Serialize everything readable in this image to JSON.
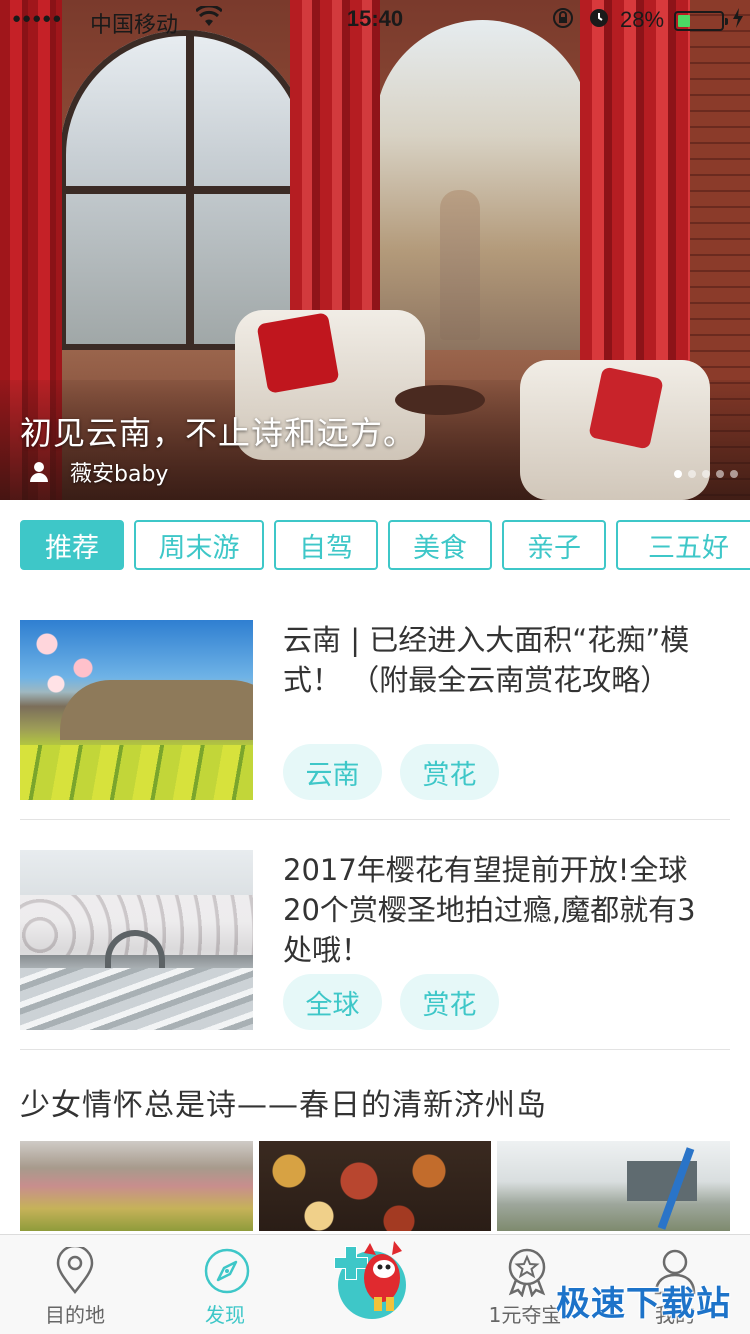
{
  "status_bar": {
    "signal": "●●●●●",
    "carrier": "中国移动",
    "time": "15:40",
    "battery_percent": "28%",
    "battery_level": 0.28,
    "icons": [
      "signal-icon",
      "wifi-icon",
      "orientation-lock-icon",
      "alarm-icon",
      "battery-icon",
      "charging-icon"
    ]
  },
  "hero": {
    "title": "初见云南，不止诗和远方。",
    "author": "薇安baby",
    "slide_count": 5,
    "active_slide": 1
  },
  "tabs": [
    {
      "label": "推荐",
      "active": true
    },
    {
      "label": "周末游",
      "active": false
    },
    {
      "label": "自驾",
      "active": false
    },
    {
      "label": "美食",
      "active": false
    },
    {
      "label": "亲子",
      "active": false
    },
    {
      "label": "三五好",
      "active": false
    }
  ],
  "articles": [
    {
      "title": "云南 | 已经进入大面积“花痴”模式！ （附最全云南赏花攻略）",
      "tags": [
        "云南",
        "赏花"
      ]
    },
    {
      "title": "2017年樱花有望提前开放!全球20个赏樱圣地拍过瘾,魔都就有3处哦！",
      "tags": [
        "全球",
        "赏花"
      ]
    }
  ],
  "feature": {
    "title": "少女情怀总是诗——春日的清新济州岛"
  },
  "bottom_nav": [
    {
      "label": "目的地",
      "icon": "location-pin-icon",
      "active": false
    },
    {
      "label": "发现",
      "icon": "compass-icon",
      "active": true
    },
    {
      "label": "",
      "icon": "mascot-plus-icon",
      "active": false
    },
    {
      "label": "1元夺宝",
      "icon": "award-star-icon",
      "active": false
    },
    {
      "label": "我的",
      "icon": "user-profile-icon",
      "active": false
    }
  ],
  "watermark": "极速下载站",
  "colors": {
    "accent": "#3ec7c8",
    "tag_bg": "#e6f8f8",
    "text": "#333333",
    "watermark": "#1d73c9"
  }
}
